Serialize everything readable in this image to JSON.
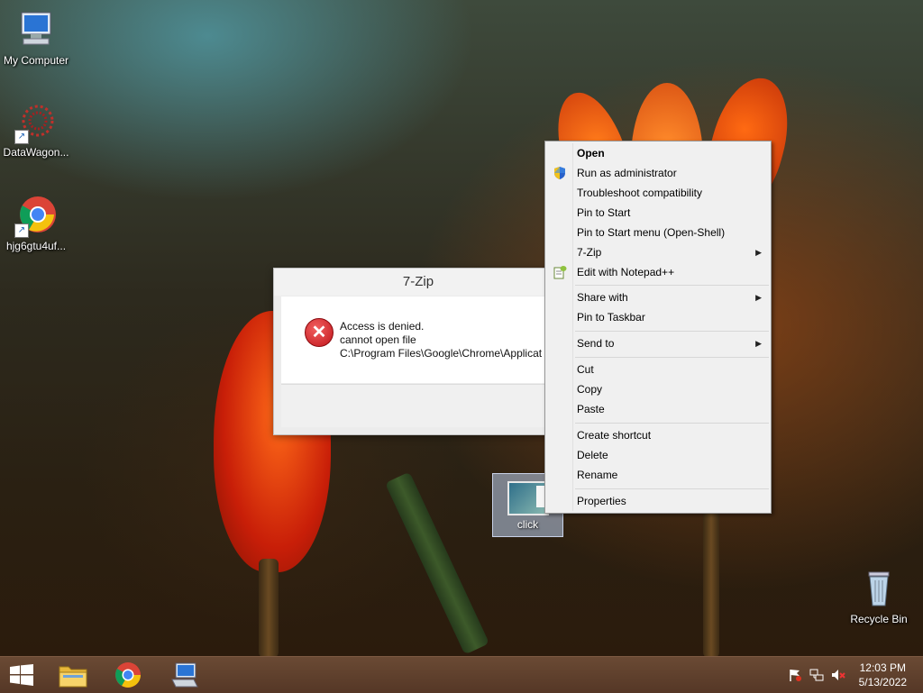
{
  "desktop": {
    "icons": [
      {
        "label": "My Computer"
      },
      {
        "label": "DataWagon..."
      },
      {
        "label": "hjg6gtu4uf..."
      },
      {
        "label": "Recycle Bin"
      }
    ],
    "dragged_icon": {
      "label": "click"
    }
  },
  "dialog": {
    "title": "7-Zip",
    "message_line1": "Access is denied.",
    "message_line2": "cannot open file",
    "message_line3": "C:\\Program Files\\Google\\Chrome\\Applicat",
    "error_glyph": "✕"
  },
  "context_menu": {
    "items": [
      {
        "label": "Open",
        "bold": true
      },
      {
        "label": "Run as administrator",
        "icon": "shield-icon"
      },
      {
        "label": "Troubleshoot compatibility"
      },
      {
        "label": "Pin to Start"
      },
      {
        "label": "Pin to Start menu (Open-Shell)"
      },
      {
        "label": "7-Zip",
        "submenu": true
      },
      {
        "label": "Edit with Notepad++",
        "icon": "notepad-plus-plus-icon"
      },
      {
        "label": "Share with",
        "submenu": true
      },
      {
        "label": "Pin to Taskbar"
      },
      {
        "label": "Send to",
        "submenu": true
      },
      {
        "label": "Cut"
      },
      {
        "label": "Copy"
      },
      {
        "label": "Paste"
      },
      {
        "label": "Create shortcut"
      },
      {
        "label": "Delete"
      },
      {
        "label": "Rename"
      },
      {
        "label": "Properties"
      }
    ],
    "submenu_arrow": "▶"
  },
  "taskbar": {
    "clock_time": "12:03 PM",
    "clock_date": "5/13/2022"
  },
  "colors": {
    "error_red": "#c0151b",
    "taskbar": "#5a3b29",
    "menu_bg": "#f0f0f0"
  }
}
